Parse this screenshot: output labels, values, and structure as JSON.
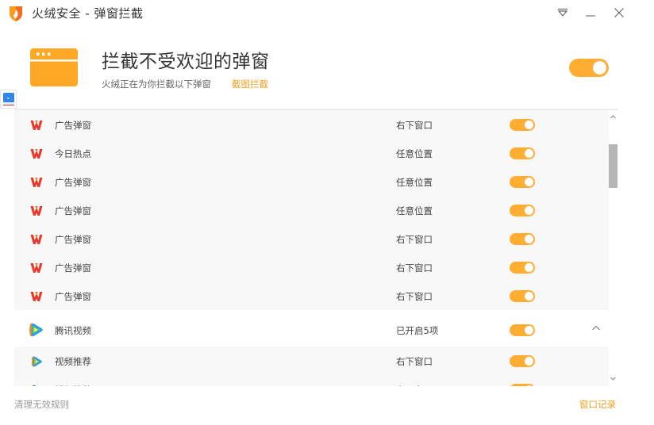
{
  "window": {
    "title": "火绒安全 - 弹窗拦截",
    "controls": {
      "menu_icon": "dropdown-triangle-icon",
      "minimize_icon": "minimize-icon",
      "close_icon": "close-icon"
    }
  },
  "header": {
    "icon": "popup-window-icon",
    "title": "拦截不受欢迎的弹窗",
    "subtitle": "火绒正在为你拦截以下弹窗",
    "link": "截图拦截",
    "master_toggle_on": true
  },
  "side_widget": {
    "icon": "book-download-icon"
  },
  "list": {
    "rows": [
      {
        "type": "sub",
        "app": "wps",
        "icon": "wps-icon",
        "name": "广告弹窗",
        "position": "右下窗口",
        "enabled": true
      },
      {
        "type": "sub",
        "app": "wps",
        "icon": "wps-icon",
        "name": "今日热点",
        "position": "任意位置",
        "enabled": true
      },
      {
        "type": "sub",
        "app": "wps",
        "icon": "wps-icon",
        "name": "广告弹窗",
        "position": "任意位置",
        "enabled": true
      },
      {
        "type": "sub",
        "app": "wps",
        "icon": "wps-icon",
        "name": "广告弹窗",
        "position": "任意位置",
        "enabled": true
      },
      {
        "type": "sub",
        "app": "wps",
        "icon": "wps-icon",
        "name": "广告弹窗",
        "position": "右下窗口",
        "enabled": true
      },
      {
        "type": "sub",
        "app": "wps",
        "icon": "wps-icon",
        "name": "广告弹窗",
        "position": "右下窗口",
        "enabled": true
      },
      {
        "type": "sub",
        "app": "wps",
        "icon": "wps-icon",
        "name": "广告弹窗",
        "position": "右下窗口",
        "enabled": true
      },
      {
        "type": "group",
        "app": "tencent-video",
        "icon": "tencent-video-icon",
        "name": "腾讯视频",
        "position": "已开启5项",
        "enabled": true,
        "expanded": true
      },
      {
        "type": "sub",
        "app": "tencent-video",
        "icon": "tencent-video-icon",
        "name": "视频推荐",
        "position": "右下窗口",
        "enabled": true
      },
      {
        "type": "sub",
        "app": "tencent-video",
        "icon": "tencent-video-icon",
        "name": "视频推荐",
        "position": "右下窗口",
        "enabled": true
      }
    ]
  },
  "footer": {
    "left_link": "清理无效规则",
    "right_link": "窗口记录"
  },
  "colors": {
    "accent": "#ffae33",
    "link": "#f0a020",
    "wps_red": "#e8392a",
    "row_bg": "#f8f8f8"
  }
}
